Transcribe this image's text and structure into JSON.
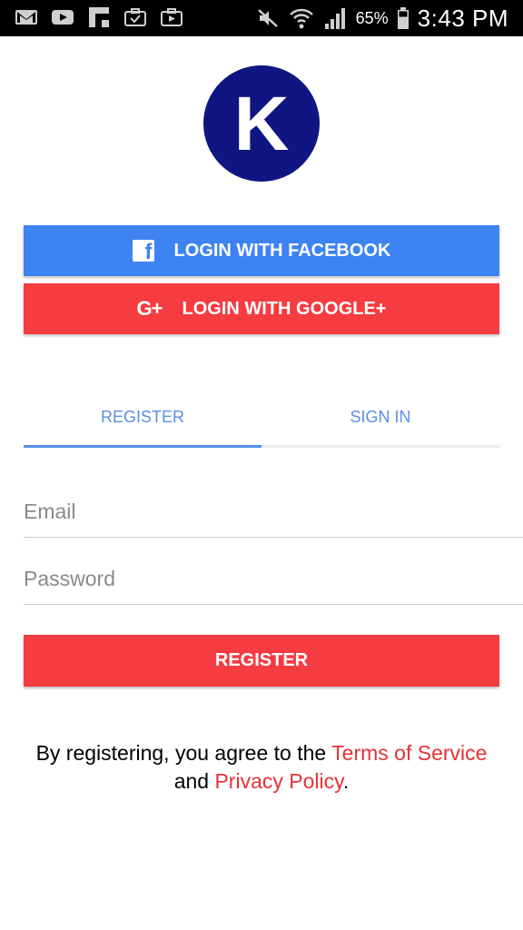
{
  "status_bar": {
    "icons_left": [
      "gmail-icon",
      "youtube-icon",
      "flipboard-icon",
      "briefcase-check-icon",
      "briefcase-play-icon"
    ],
    "battery_percent": "65%",
    "time": "3:43 PM"
  },
  "logo": {
    "letter": "K",
    "color": "#0f1582"
  },
  "social": {
    "facebook_label": "LOGIN WITH FACEBOOK",
    "facebook_color": "#3d83f2",
    "google_label": "LOGIN WITH GOOGLE+",
    "google_icon_text": "G+",
    "google_color": "#f43c41"
  },
  "tabs": [
    {
      "label": "REGISTER",
      "active": true
    },
    {
      "label": "SIGN IN",
      "active": false
    }
  ],
  "form": {
    "email_placeholder": "Email",
    "password_placeholder": "Password",
    "submit_label": "REGISTER"
  },
  "terms": {
    "prefix": "By registering, you agree to the ",
    "tos_link": "Terms of Service",
    "middle": "and ",
    "privacy_link": "Privacy Policy",
    "suffix": "."
  }
}
